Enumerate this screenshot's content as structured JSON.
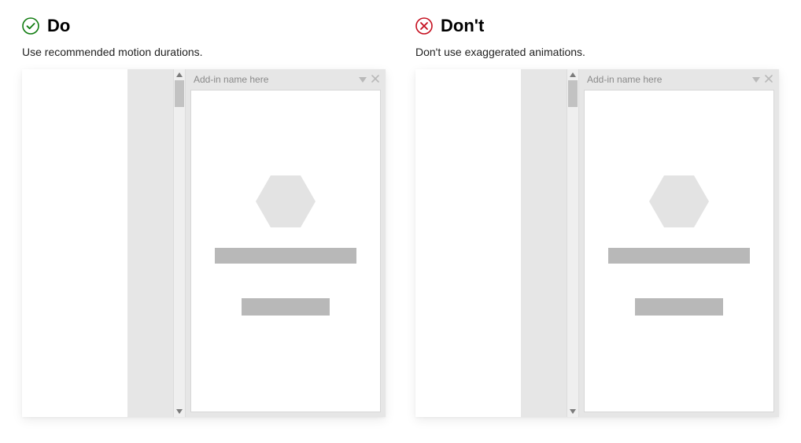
{
  "do": {
    "title": "Do",
    "subtitle": "Use recommended motion durations.",
    "icon_color": "#107c10",
    "pane_title": "Add-in name here"
  },
  "dont": {
    "title": "Don't",
    "subtitle": "Don't use exaggerated animations.",
    "icon_color": "#c50f1f",
    "pane_title": "Add-in name here"
  }
}
